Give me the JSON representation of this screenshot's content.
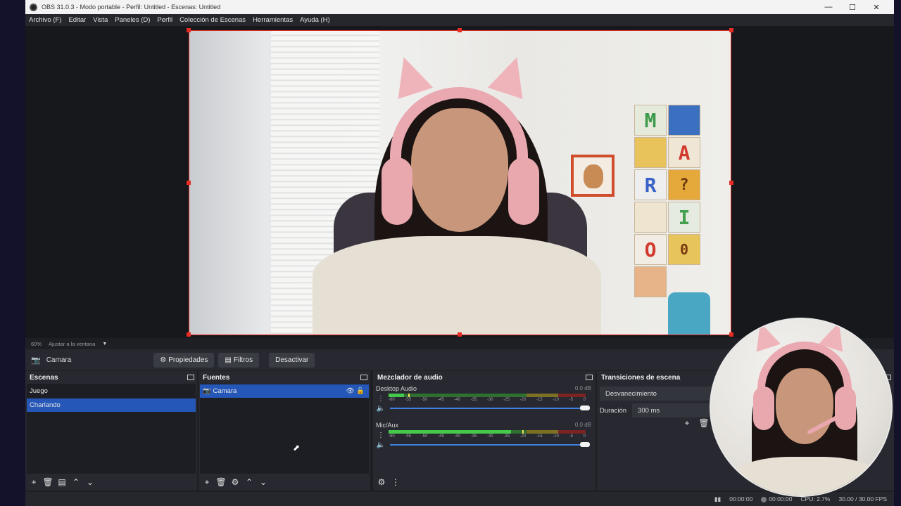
{
  "window": {
    "title": "OBS 31.0.3 - Modo portable - Perfil: Untitled - Escenas: Untitled"
  },
  "menu": [
    "Archivo (F)",
    "Editar",
    "Vista",
    "Paneles (D)",
    "Perfil",
    "Colección de Escenas",
    "Herramientas",
    "Ayuda (H)"
  ],
  "preview": {
    "zoom": "60%",
    "fit_label": "Ajustar a la ventana",
    "board_letters": [
      "M",
      "",
      "",
      "A",
      "R",
      "?",
      "",
      "I",
      "O",
      "0"
    ]
  },
  "source_bar": {
    "selected_source": "Camara",
    "properties": "Propiedades",
    "filters": "Filtros",
    "deactivate": "Desactivar"
  },
  "scenes": {
    "title": "Escenas",
    "items": [
      "Juego",
      "Charlando"
    ],
    "selected_index": 1
  },
  "sources": {
    "title": "Fuentes",
    "items": [
      "Camara"
    ]
  },
  "mixer": {
    "title": "Mezclador de audio",
    "channels": [
      {
        "name": "Desktop Audio",
        "db": "0.0 dB",
        "level": 0.08,
        "peak": 0.1,
        "volume": 1.0
      },
      {
        "name": "Mic/Aux",
        "db": "0.0 dB",
        "level": 0.62,
        "peak": 0.68,
        "volume": 1.0
      }
    ],
    "scale": [
      "-60",
      "-55",
      "-50",
      "-45",
      "-40",
      "-35",
      "-30",
      "-25",
      "-20",
      "-15",
      "-10",
      "-5",
      "0"
    ]
  },
  "transitions": {
    "title": "Transiciones de escena",
    "selected": "Desvanecimiento",
    "duration_label": "Duración",
    "duration_value": "300 ms"
  },
  "status": {
    "rec_time": "00:00:00",
    "stream_time": "00:00:00",
    "cpu": "CPU: 2.7%",
    "fps": "30.00 / 30.00 FPS"
  }
}
